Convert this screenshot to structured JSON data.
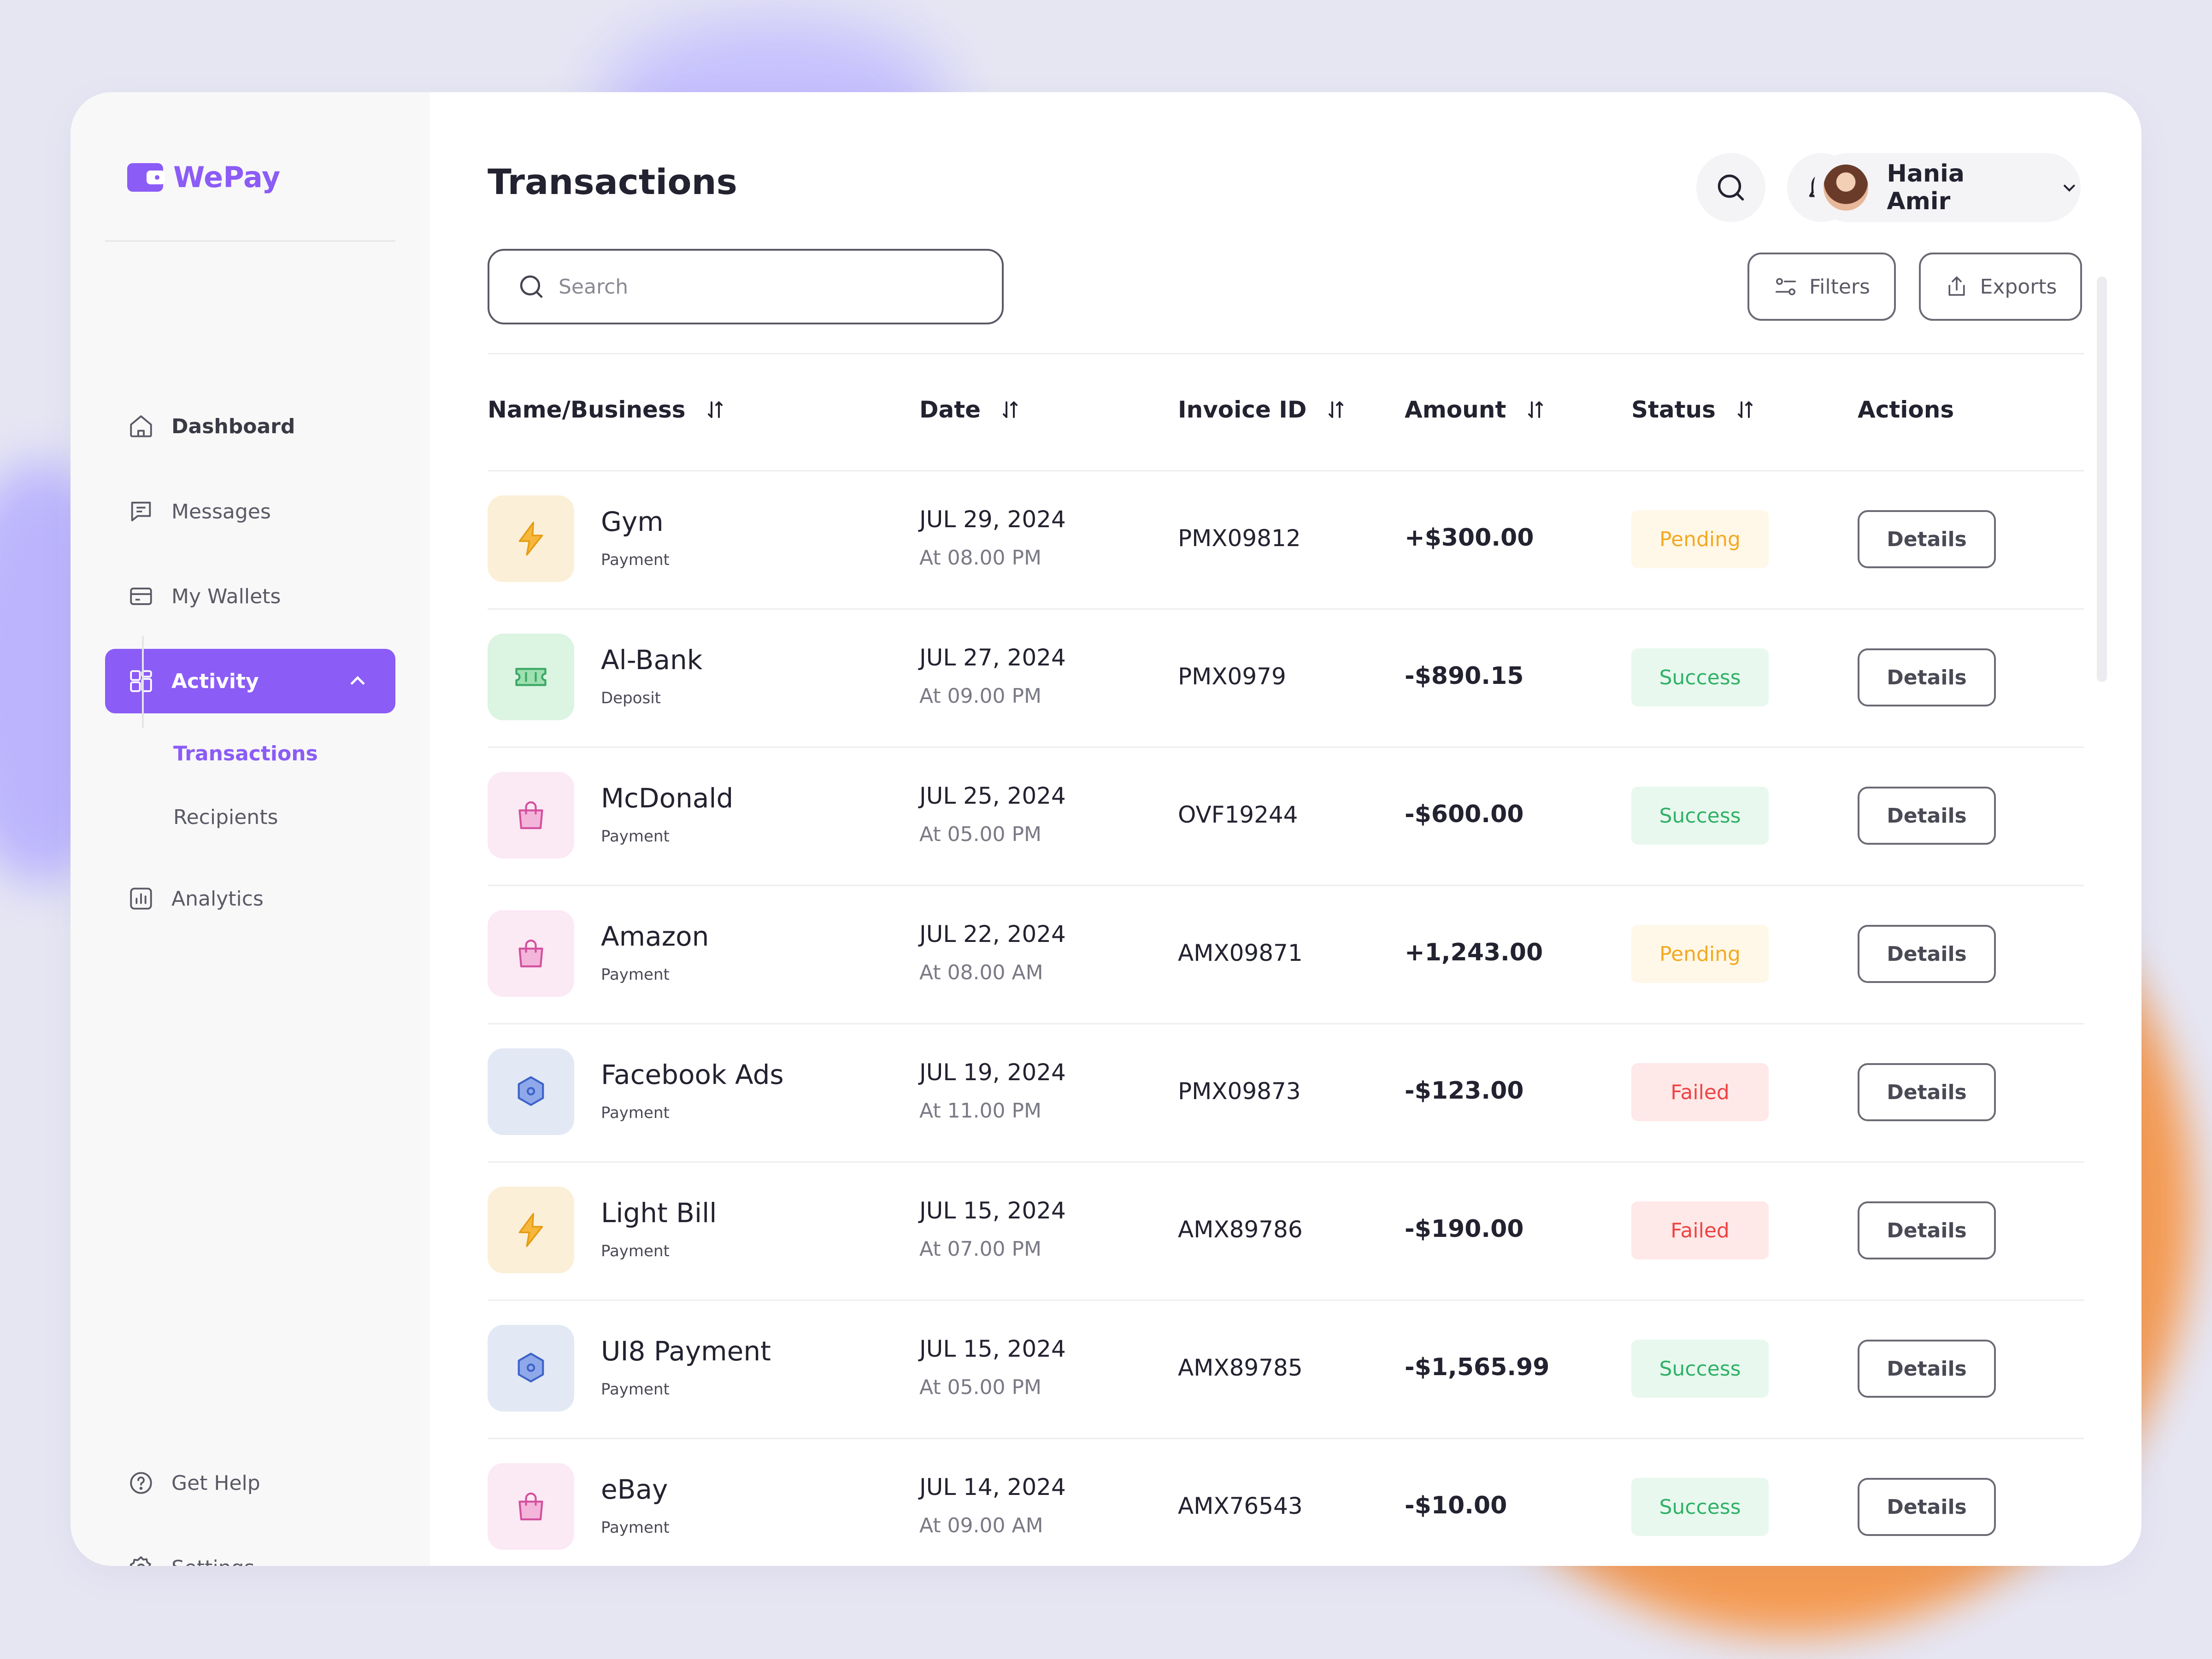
{
  "app": {
    "name": "WePay"
  },
  "sidebar": {
    "items": [
      {
        "label": "Dashboard",
        "icon": "home-icon"
      },
      {
        "label": "Messages",
        "icon": "message-icon"
      },
      {
        "label": "My Wallets",
        "icon": "wallet-icon"
      },
      {
        "label": "Activity",
        "icon": "activity-icon",
        "expanded": true
      },
      {
        "label": "Analytics",
        "icon": "analytics-icon"
      }
    ],
    "sub_items": [
      {
        "label": "Transactions",
        "active": true
      },
      {
        "label": "Recipients",
        "active": false
      }
    ],
    "footer": [
      {
        "label": "Get Help",
        "icon": "help-icon"
      },
      {
        "label": "Settings",
        "icon": "gear-icon"
      }
    ]
  },
  "header": {
    "title": "Transactions",
    "user_name": "Hania Amir",
    "notification_dot": true
  },
  "toolbar": {
    "search_placeholder": "Search",
    "filters_label": "Filters",
    "exports_label": "Exports"
  },
  "table": {
    "columns": [
      "Name/Business",
      "Date",
      "Invoice ID",
      "Amount",
      "Status",
      "Actions"
    ],
    "rows": [
      {
        "name": "Gym",
        "type": "Payment",
        "date": "JUL 29, 2024",
        "time": "At 08.00 PM",
        "invoice": "PMX09812",
        "amount": "+$300.00",
        "status": "Pending",
        "status_kind": "pending",
        "icon": "lightning-icon",
        "action": "Details"
      },
      {
        "name": "Al-Bank",
        "type": "Deposit",
        "date": "JUL 27, 2024",
        "time": "At 09.00 PM",
        "invoice": "PMX0979",
        "amount": "-$890.15",
        "status": "Success",
        "status_kind": "success",
        "icon": "ticket-icon",
        "action": "Details"
      },
      {
        "name": "McDonald",
        "type": "Payment",
        "date": "JUL 25, 2024",
        "time": "At 05.00 PM",
        "invoice": "OVF19244",
        "amount": "-$600.00",
        "status": "Success",
        "status_kind": "success",
        "icon": "shopping-bag-icon",
        "action": "Details"
      },
      {
        "name": "Amazon",
        "type": "Payment",
        "date": "JUL 22, 2024",
        "time": "At 08.00 AM",
        "invoice": "AMX09871",
        "amount": "+1,243.00",
        "status": "Pending",
        "status_kind": "pending",
        "icon": "shopping-bag-icon",
        "action": "Details"
      },
      {
        "name": "Facebook Ads",
        "type": "Payment",
        "date": "JUL 19, 2024",
        "time": "At 11.00 PM",
        "invoice": "PMX09873",
        "amount": "-$123.00",
        "status": "Failed",
        "status_kind": "failed",
        "icon": "hexagon-icon",
        "action": "Details"
      },
      {
        "name": "Light Bill",
        "type": "Payment",
        "date": "JUL 15, 2024",
        "time": "At 07.00 PM",
        "invoice": "AMX89786",
        "amount": "-$190.00",
        "status": "Failed",
        "status_kind": "failed",
        "icon": "lightning-icon",
        "action": "Details"
      },
      {
        "name": "UI8 Payment",
        "type": "Payment",
        "date": "JUL 15, 2024",
        "time": "At 05.00 PM",
        "invoice": "AMX89785",
        "amount": "-$1,565.99",
        "status": "Success",
        "status_kind": "success",
        "icon": "hexagon-icon",
        "action": "Details"
      },
      {
        "name": "eBay",
        "type": "Payment",
        "date": "JUL 14, 2024",
        "time": "At 09.00 AM",
        "invoice": "AMX76543",
        "amount": "-$10.00",
        "status": "Success",
        "status_kind": "success",
        "icon": "shopping-bag-icon",
        "action": "Details"
      }
    ]
  },
  "colors": {
    "accent": "#8b5cf6",
    "pending": "#f2a922",
    "success": "#2fb167",
    "failed": "#ee4343",
    "notification": "#f04438"
  }
}
